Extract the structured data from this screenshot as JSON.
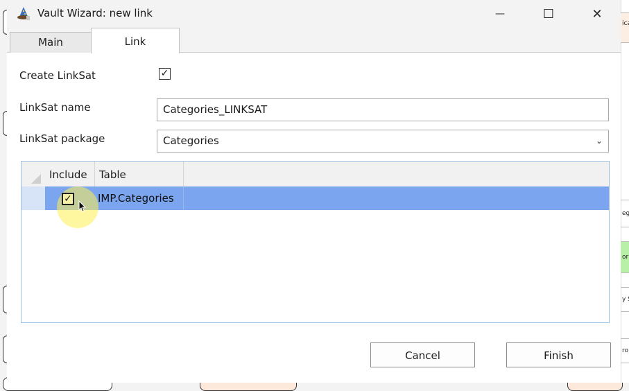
{
  "window": {
    "title": "Vault Wizard: new link",
    "minimize_glyph": "—",
    "maximize_glyph": "☐",
    "close_glyph": "✕",
    "icon": "wizard-hat-icon"
  },
  "tabs": [
    {
      "label": "Main",
      "active": false
    },
    {
      "label": "Link",
      "active": true
    }
  ],
  "form": {
    "create_linksat_label": "Create LinkSat",
    "create_linksat_checked": true,
    "linksat_name_label": "LinkSat name",
    "linksat_name_value": "Categories_LINKSAT",
    "linksat_package_label": "LinkSat package",
    "linksat_package_value": "Categories"
  },
  "grid": {
    "columns": [
      "Include",
      "Table"
    ],
    "rows": [
      {
        "include": true,
        "table": "IMP.Categories",
        "selected": true
      }
    ]
  },
  "buttons": {
    "cancel": "Cancel",
    "finish": "Finish"
  },
  "background_fragments": [
    "ica",
    "eg",
    "or",
    "y S",
    "ro"
  ],
  "colors": {
    "selected_row": "#7ba5ef",
    "cursor_highlight": "#fff050"
  }
}
